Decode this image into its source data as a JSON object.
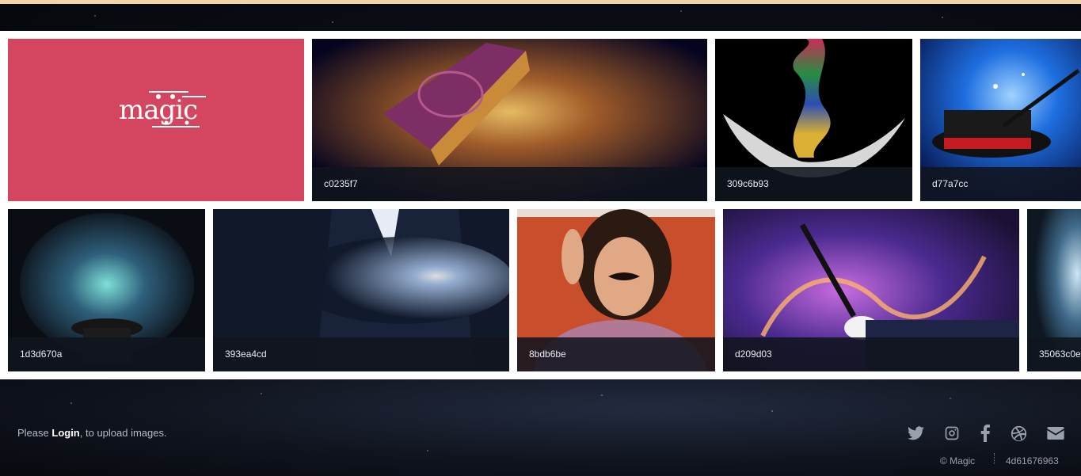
{
  "gallery": {
    "logo_text": "magic",
    "tiles": [
      {
        "caption": "c0235f7"
      },
      {
        "caption": "309c6b93"
      },
      {
        "caption": "d77a7cc"
      },
      {
        "caption": "1d3d670a"
      },
      {
        "caption": "393ea4cd"
      },
      {
        "caption": "8bdb6be"
      },
      {
        "caption": "d209d03"
      },
      {
        "caption": "35063c0e"
      }
    ]
  },
  "footer": {
    "upload_prefix": "Please ",
    "login_link": "Login",
    "upload_suffix": ", to upload images.",
    "social_icons": [
      "twitter-icon",
      "instagram-icon",
      "facebook-icon",
      "dribbble-icon",
      "mail-icon"
    ],
    "copyright": "© Magic",
    "build_id": "4d61676963"
  },
  "colors": {
    "logo_tile": "#d4465f",
    "top_strip": "#f2d4a6",
    "caption_bg": "#10141e",
    "icon": "#9aa1ad"
  }
}
